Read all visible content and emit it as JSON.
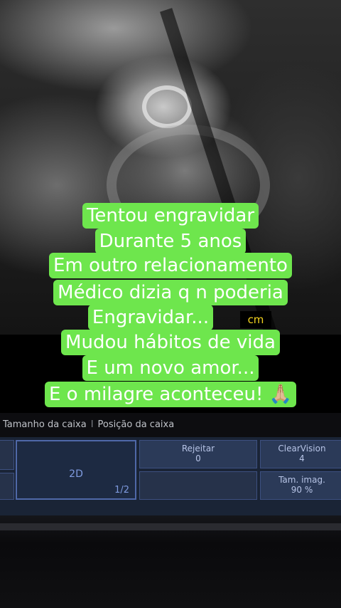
{
  "caption": {
    "lines": [
      "Tentou engravidar",
      "Durante 5 anos",
      "Em outro relacionamento",
      "Médico dizia q n poderia",
      "Engravidar...",
      "Mudou hábitos de vida",
      "E um novo amor...",
      "E o milagre aconteceu! 🙏🏼"
    ],
    "color": "#6ee64d"
  },
  "scan": {
    "unit_label": "cm"
  },
  "toolbar": {
    "item1": "Tamanho da caixa",
    "separator": "I",
    "item2": "Posição da caixa"
  },
  "panel": {
    "mode": {
      "label": "2D",
      "page": "1/2"
    },
    "reject": {
      "label": "Rejeitar",
      "value": "0"
    },
    "clearvision": {
      "label": "ClearVision",
      "value": "4"
    },
    "image_size": {
      "label": "Tam. imag.",
      "value": "90 %"
    }
  }
}
